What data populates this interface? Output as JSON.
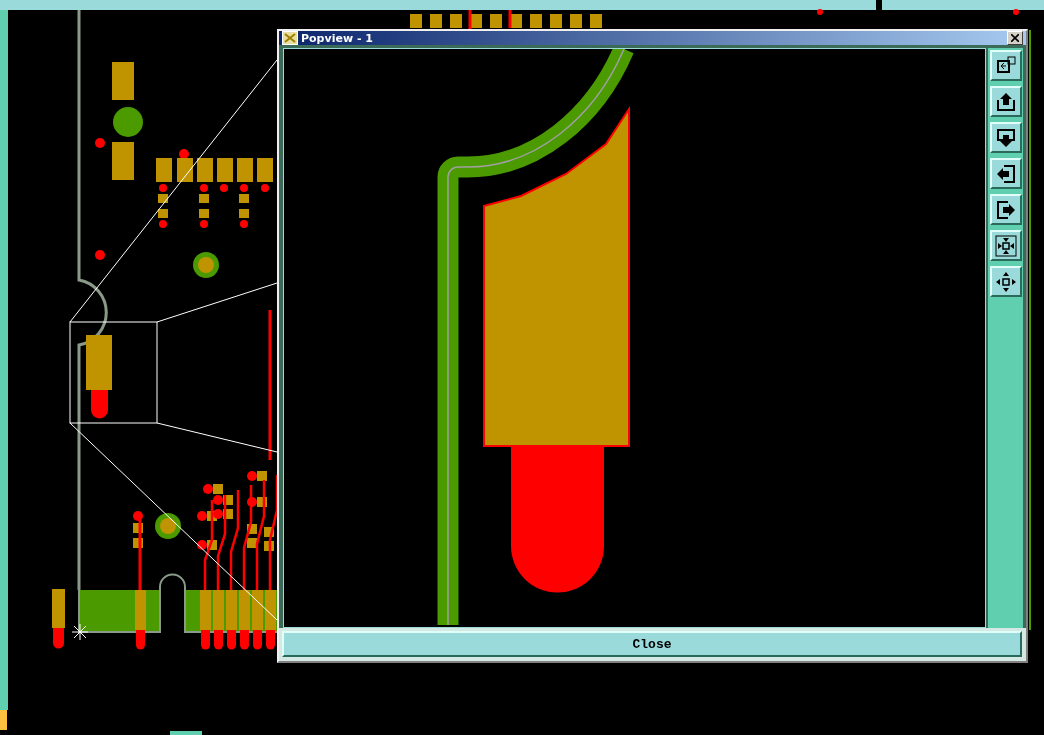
{
  "popview": {
    "title": "Popview - 1",
    "close_button": "Close"
  }
}
